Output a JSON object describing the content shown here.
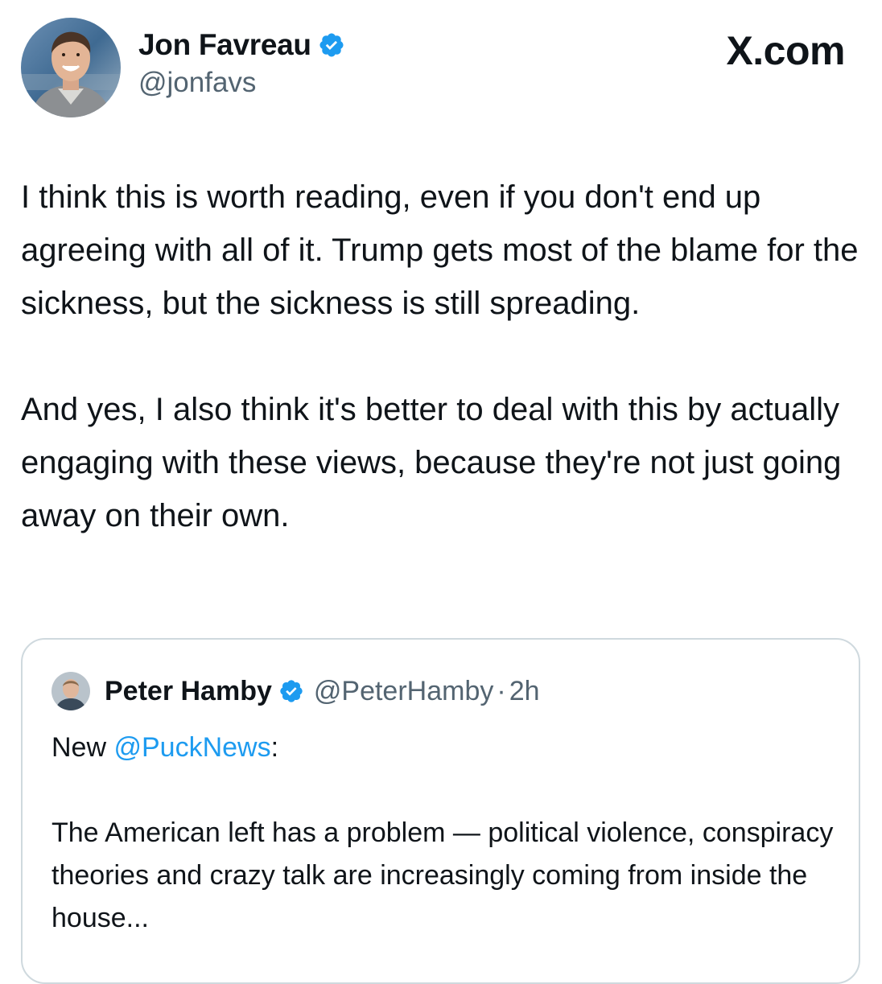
{
  "brand": {
    "label": "X.com"
  },
  "tweet": {
    "author_name": "Jon Favreau",
    "author_handle": "@jonfavs",
    "avatar_icon": "avatar-photo-icon",
    "verified_icon": "verified-badge-icon",
    "paragraphs": [
      "I think this is worth reading, even if you don't end up agreeing with all of it. Trump gets most of the blame for the sickness, but the sickness is still spreading.",
      "And yes, I also think it's better to deal with this by actually engaging with these views, because they're not just going away on their own."
    ]
  },
  "quote": {
    "author_name": "Peter Hamby",
    "author_handle": "@PeterHamby",
    "separator": "·",
    "time": "2h",
    "line1_prefix": "New ",
    "line1_mention": "@PuckNews",
    "line1_suffix": ":",
    "body": "The American left has a problem — political violence, conspiracy theories and crazy talk are increasingly coming from inside the house..."
  },
  "colors": {
    "text": "#0f1419",
    "secondary": "#536471",
    "accent": "#1d9bf0",
    "border": "#cfd9de"
  }
}
